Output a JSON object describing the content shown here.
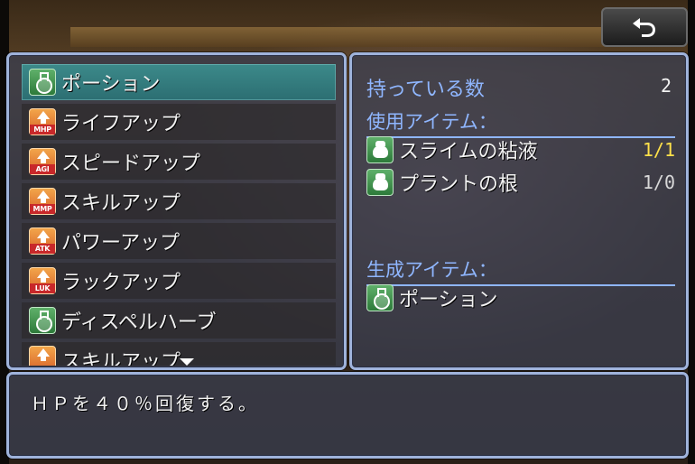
{
  "header": {
    "back_icon": "return-arrow-icon"
  },
  "recipe_list": {
    "items": [
      {
        "label": "ポーション",
        "icon": "flask-icon",
        "tag": "",
        "selected": true
      },
      {
        "label": "ライフアップ",
        "icon": "stat-up-icon",
        "tag": "MHP",
        "selected": false
      },
      {
        "label": "スピードアップ",
        "icon": "stat-up-icon",
        "tag": "AGI",
        "selected": false
      },
      {
        "label": "スキルアップ",
        "icon": "stat-up-icon",
        "tag": "MMP",
        "selected": false
      },
      {
        "label": "パワーアップ",
        "icon": "stat-up-icon",
        "tag": "ATK",
        "selected": false
      },
      {
        "label": "ラックアップ",
        "icon": "stat-up-icon",
        "tag": "LUK",
        "selected": false
      },
      {
        "label": "ディスペルハーブ",
        "icon": "flask-icon",
        "tag": "",
        "selected": false
      },
      {
        "label": "スキルアップ",
        "icon": "stat-up-icon",
        "tag": "",
        "selected": false
      }
    ],
    "scroll_icon": "scroll-down-arrow-icon"
  },
  "detail": {
    "owned_label": "持っている数",
    "owned_value": "2",
    "materials_title": "使用アイテム：",
    "materials": [
      {
        "label": "スライムの粘液",
        "count": "1/1",
        "icon": "bag-icon",
        "sufficient": true
      },
      {
        "label": "プラントの根",
        "count": "1/0",
        "icon": "bag-icon",
        "sufficient": false
      }
    ],
    "result_title": "生成アイテム：",
    "result": {
      "label": "ポーション",
      "icon": "flask-icon"
    }
  },
  "description": {
    "text": "ＨＰを４０％回復する。"
  },
  "colors": {
    "panel_border": "#9fb3db",
    "heading_blue": "#8fb6ff",
    "selected_bg": "#2c6e72",
    "sufficient_yellow": "#ffe14a"
  }
}
